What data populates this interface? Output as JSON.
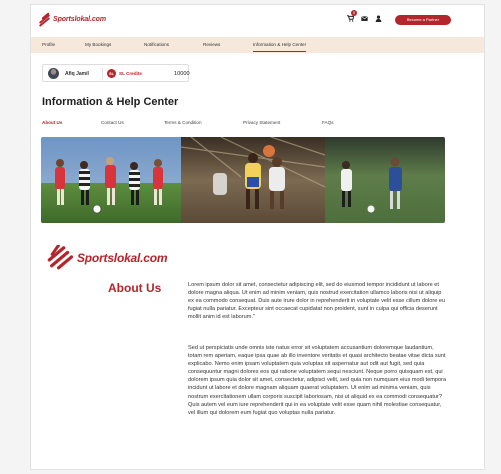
{
  "header": {
    "brand": "Sportslokal.com",
    "cart_badge": "0",
    "partner_button": "Become a Partner",
    "icons": [
      "cart-icon",
      "mail-icon",
      "user-icon"
    ]
  },
  "nav": {
    "items": [
      {
        "label": "Profile",
        "active": false
      },
      {
        "label": "My Bookings",
        "active": false
      },
      {
        "label": "Notifications",
        "active": false
      },
      {
        "label": "Reviews",
        "active": false
      },
      {
        "label": "Information & Help Center",
        "active": true
      }
    ]
  },
  "user": {
    "name": "Afiq Jamil",
    "credits_icon": "SL",
    "credits_label": "SL Credits",
    "credits_value": "10000"
  },
  "page": {
    "title": "Information & Help Center"
  },
  "tabs": [
    {
      "label": "About Us",
      "active": true
    },
    {
      "label": "Contact Us",
      "active": false
    },
    {
      "label": "Terms & Condition",
      "active": false
    },
    {
      "label": "Privacy Statement",
      "active": false
    },
    {
      "label": "FAQs",
      "active": false
    }
  ],
  "about": {
    "brand": "Sportslokal.com",
    "heading": "About Us",
    "paragraph1": "Lorem ipsum dolor sit amet, consectetur adipiscing elit, sed do eiusmod tempor incididunt ut labore et dolore magna aliqua. Ut enim ad minim veniam, quis nostrud exercitation ullamco laboris nisi ut aliquip ex ea commodo consequat. Duis aute irure dolor in reprehenderit in voluptate velit esse cillum dolore eu fugiat nulla pariatur. Excepteur sint occaecat cupidatat non proident, sunt in culpa qui officia deserunt mollit anim id est laborum.\"",
    "paragraph2": "Sed ut perspiciatis unde omnis iste natus error sit voluptatem accusantium doloremque laudantium, totam rem aperiam, eaque ipsa quae ab illo inventore veritatis et quasi architecto beatae vitae dicta sunt explicabo. Nemo enim ipsam voluptatem quia voluptas sit aspernatur aut odit aut fugit, sed quia consequuntur magni dolores eos qui ratione voluptatem sequi nesciunt. Neque porro quisquam est, qui dolorem ipsum quia dolor sit amet, consectetur, adipisci velit, sed quia non numquam eius modi tempora incidunt ut labore et dolore magnam aliquam quaerat voluptatem. Ut enim ad minima veniam, quis nostrum exercitationem ullam corporis suscipit laboriosam, nisi ut aliquid ex ea commodi consequatur? Quis autem vel eum iure reprehenderit qui in ea voluptate velit esse quam nihil molestiae consequatur, vel illum qui dolorem eum fugiat quo voluptas nulla pariatur."
  },
  "colors": {
    "brand": "#b3262b",
    "nav_background": "#f6e9dc"
  }
}
